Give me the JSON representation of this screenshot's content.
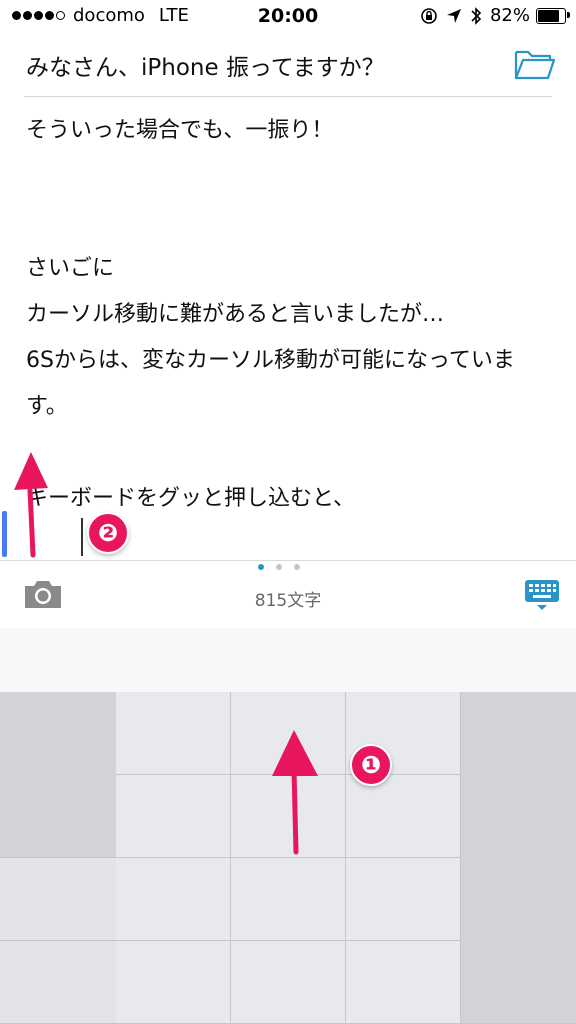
{
  "status_bar": {
    "carrier": "docomo",
    "network": "LTE",
    "time": "20:00",
    "battery_percent": "82%",
    "battery_level": 0.82,
    "icons": [
      "rotation-lock-icon",
      "location-arrow-icon",
      "bluetooth-icon"
    ]
  },
  "document": {
    "title": "みなさん、iPhone 振ってますか？",
    "lines": [
      "そういった場合でも、一振り！",
      "",
      "",
      "さいごに",
      "カーソル移動に難があると言いましたが…",
      "6Sからは、変なカーソル移動が可能になっています。",
      "",
      "キーボードをグッと押し込むと、"
    ]
  },
  "annotations": {
    "badge_1": "❶",
    "badge_2": "❷",
    "color": "#e8175d"
  },
  "toolbar": {
    "char_count": "815文字",
    "page_dots": 3,
    "active_page": 1,
    "icons": [
      "camera-icon",
      "keyboard-icon",
      "folder-icon"
    ]
  },
  "colors": {
    "accent": "#2a94c8",
    "cursor": "#4a7cf0",
    "annotation": "#e8175d"
  }
}
